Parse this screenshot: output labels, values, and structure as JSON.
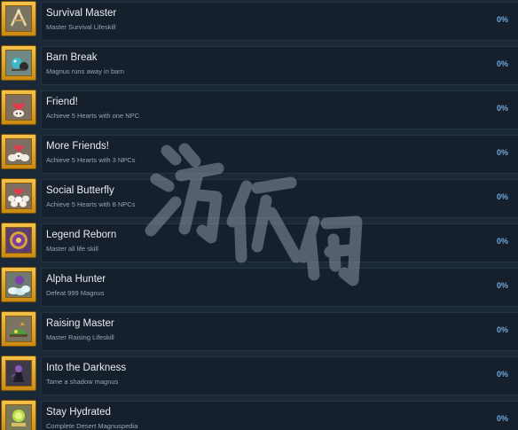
{
  "achievements": [
    {
      "title": "Survival Master",
      "description": "Master Survival Lifeskill",
      "progress": "0%",
      "icon": "tools-icon"
    },
    {
      "title": "Barn Break",
      "description": "Magnus runs away in barn",
      "progress": "0%",
      "icon": "creature-icon"
    },
    {
      "title": "Friend!",
      "description": "Achieve 5 Hearts with one NPC",
      "progress": "0%",
      "icon": "heart-icon"
    },
    {
      "title": "More Friends!",
      "description": "Achieve 5 Hearts with 3 NPCs",
      "progress": "0%",
      "icon": "hearts-icon"
    },
    {
      "title": "Social Butterfly",
      "description": "Achieve 5 Hearts with 8 NPCs",
      "progress": "0%",
      "icon": "many-hearts-icon"
    },
    {
      "title": "Legend Reborn",
      "description": "Master all life skill",
      "progress": "0%",
      "icon": "emblem-icon"
    },
    {
      "title": "Alpha Hunter",
      "description": "Defeat 999 Magnus",
      "progress": "0%",
      "icon": "hunter-icon"
    },
    {
      "title": "Raising Master",
      "description": "Master Raising Lifeskill",
      "progress": "0%",
      "icon": "raising-icon"
    },
    {
      "title": "Into the Darkness",
      "description": "Tame a shadow magnus",
      "progress": "0%",
      "icon": "shadow-icon"
    },
    {
      "title": "Stay Hydrated",
      "description": "Complete Desert Magnuspedia",
      "progress": "0%",
      "icon": "drink-icon"
    }
  ],
  "watermark": {
    "text": "游侠网"
  },
  "colors": {
    "background": "#1b2838",
    "row": "#16202d",
    "badge": "#e0a82e",
    "progress": "#6fa8dc"
  }
}
